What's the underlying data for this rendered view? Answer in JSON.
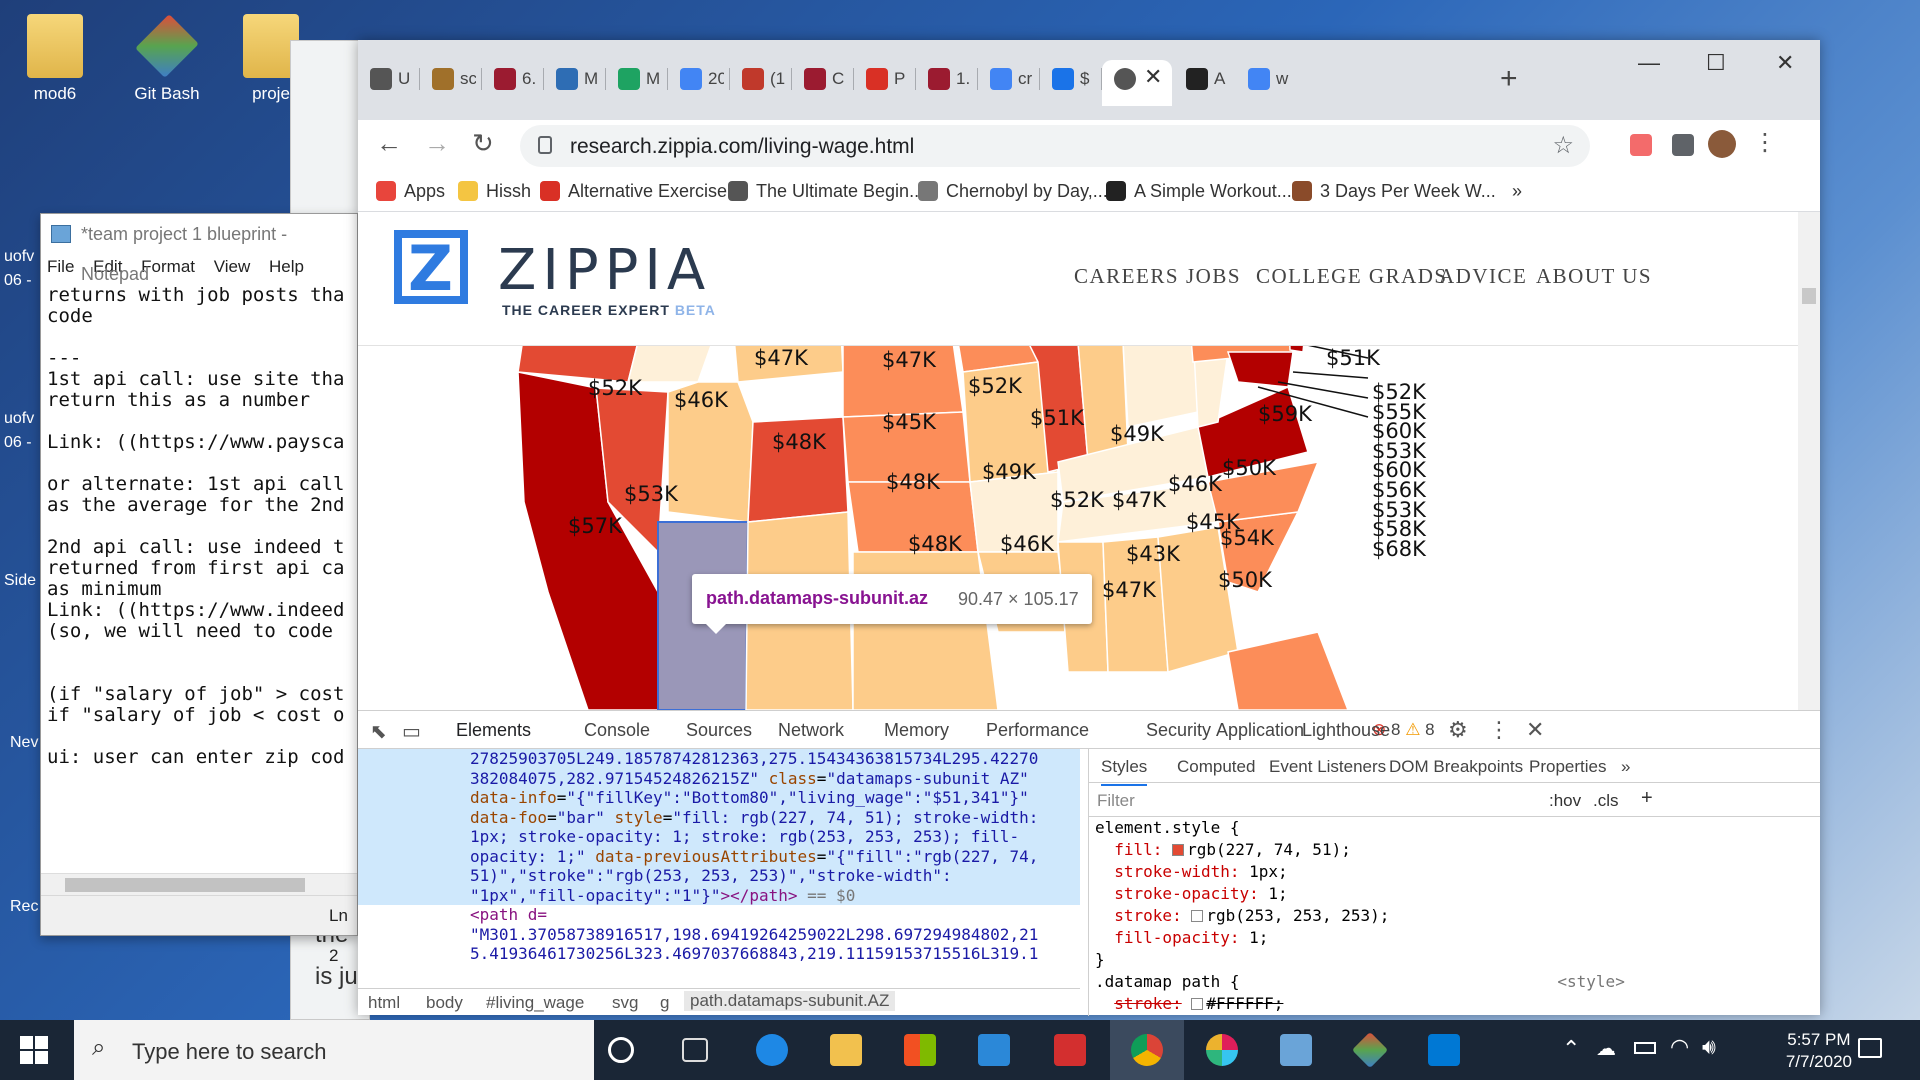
{
  "desktop": {
    "icons": [
      {
        "label": "mod6"
      },
      {
        "label": "Git Bash"
      },
      {
        "label": "proje"
      }
    ],
    "side_labels": [
      "uofv",
      "06 -",
      "uofv",
      "06 -",
      "Side",
      "Nev",
      "Rec"
    ]
  },
  "notepad": {
    "title": "*team project 1 blueprint - Notepad",
    "menu": [
      "File",
      "Edit",
      "Format",
      "View",
      "Help"
    ],
    "lines": [
      "returns with job posts tha",
      "code",
      "",
      "---",
      "1st api call: use site tha",
      "return this as a number",
      "",
      "Link: ((https://www.paysca",
      "",
      "or alternate: 1st api call",
      "as the average for the 2nd",
      "",
      "2nd api call: use indeed t",
      "returned from first api ca",
      "as minimum",
      "Link: ((https://www.indeed",
      "(so, we will need to code",
      "",
      "",
      "(if \"salary of job\" > cost",
      "if \"salary of job < cost o",
      "",
      "ui: user can enter zip cod"
    ],
    "status": "Ln 2"
  },
  "bg_window": {
    "fragments": [
      "the",
      "is ju"
    ]
  },
  "browser": {
    "tabs": [
      {
        "title": "U",
        "color": "#555"
      },
      {
        "title": "sc",
        "color": "#a0702a"
      },
      {
        "title": "6.",
        "color": "#9b1b30"
      },
      {
        "title": "M",
        "color": "#2e6db4"
      },
      {
        "title": "M",
        "color": "#1ea362"
      },
      {
        "title": "20",
        "color": "#4285f4"
      },
      {
        "title": "(1",
        "color": "#c0392b"
      },
      {
        "title": "C",
        "color": "#9b1b30"
      },
      {
        "title": "P",
        "color": "#d93025"
      },
      {
        "title": "1.",
        "color": "#9b1b30"
      },
      {
        "title": "cr",
        "color": "#4285f4"
      },
      {
        "title": "$",
        "color": "#1a73e8"
      }
    ],
    "active_tab_close": "✕",
    "trailing_tabs": [
      {
        "title": "A",
        "color": "#222"
      },
      {
        "title": "w",
        "color": "#4285f4"
      }
    ],
    "url": "research.zippia.com/living-wage.html",
    "bookmarks": [
      {
        "label": "Apps",
        "color": "#e8453c"
      },
      {
        "label": "Hissh",
        "color": "#f4c542"
      },
      {
        "label": "Alternative Exercise...",
        "color": "#d93025"
      },
      {
        "label": "The Ultimate Begin...",
        "color": "#555"
      },
      {
        "label": "Chernobyl by Day,...",
        "color": "#777"
      },
      {
        "label": "A Simple Workout...",
        "color": "#222"
      },
      {
        "label": "3 Days Per Week W...",
        "color": "#8a4b2a"
      }
    ],
    "bookmarks_more": "»"
  },
  "site": {
    "logo": "ZIPPIA",
    "tagline": "THE CAREER EXPERT",
    "beta": "BETA",
    "nav": [
      "CAREERS",
      "JOBS",
      "COLLEGE GRADS",
      "ADVICE",
      "ABOUT US"
    ],
    "map_labels": [
      "$52K",
      "$46K",
      "$47K",
      "$47K",
      "$52K",
      "$45K",
      "$48K",
      "$51K",
      "$49K",
      "$59K",
      "$48K",
      "$49K",
      "$53K",
      "$57K",
      "$52K",
      "$47K",
      "$46K",
      "$45K",
      "$50K",
      "$54K",
      "$48K",
      "$46K",
      "$43K",
      "$47K",
      "$50K",
      "$47K",
      "$51K"
    ],
    "map_right_labels": [
      "$52K",
      "$55K",
      "$60K",
      "$53K",
      "$60K",
      "$56K",
      "$53K",
      "$58K",
      "$68K"
    ],
    "tooltip_selector": "path.datamaps-subunit.az",
    "tooltip_dims": "90.47 × 105.17"
  },
  "devtools": {
    "tabs": [
      "Elements",
      "Console",
      "Sources",
      "Network",
      "Memory",
      "Performance",
      "Security",
      "Application",
      "Lighthouse"
    ],
    "errors": "8",
    "warnings": "8",
    "code": {
      "l1": "27825903705L249.18578742812363,275.15434363815734L295.42270",
      "l2": "382084075,282.97154524826215Z\"",
      "class_attr": "class",
      "class_val": "\"datamaps-subunit AZ\"",
      "info_attr": "data-info",
      "info_val": "\"{\"fillKey\":\"Bottom80\",\"living_wage\":\"$51,341\"}\"",
      "foo_attr": "data-foo",
      "foo_val": "\"bar\"",
      "style_attr": "style",
      "style_val1": "\"fill: rgb(227, 74, 51); stroke-width:",
      "style_val2": "1px; stroke-opacity: 1; stroke: rgb(253, 253, 253); fill-",
      "style_val3": "opacity: 1;\"",
      "prev_attr": "data-previousAttributes",
      "prev_val1": "\"{\"fill\":\"rgb(227, 74,",
      "prev_val2": "51)\",\"stroke\":\"rgb(253, 253, 253)\",\"stroke-width\":",
      "prev_val3": "\"1px\",\"fill-opacity\":\"1\"}\"",
      "close_tag": "></path>",
      "eq": "== $0",
      "next_tag": "<path d=",
      "next_l1": "\"M301.37058738916517,198.69419264259022L298.697294984802,21",
      "next_l2": "5.41936461730256L323.4697037668843,219.11159153715516L319.1"
    },
    "crumbs": [
      "html",
      "body",
      "#living_wage",
      "svg",
      "g",
      "path.datamaps-subunit.AZ"
    ],
    "style_tabs": [
      "Styles",
      "Computed",
      "Event Listeners",
      "DOM Breakpoints",
      "Properties",
      "»"
    ],
    "filter_placeholder": "Filter",
    "hov": ":hov",
    "cls": ".cls",
    "rules": {
      "selector1": "element.style {",
      "fill_prop": "fill:",
      "fill_val": "rgb(227, 74, 51);",
      "sw_prop": "stroke-width:",
      "sw_val": "1px;",
      "so_prop": "stroke-opacity:",
      "so_val": "1;",
      "stroke_prop": "stroke:",
      "stroke_val": "rgb(253, 253, 253);",
      "fo_prop": "fill-opacity:",
      "fo_val": "1;",
      "close": "}",
      "selector2": ".datamap path {",
      "source2": "<style>",
      "stroke2_prop": "stroke:",
      "stroke2_val": "#FFFFFF;"
    }
  },
  "taskbar": {
    "search_placeholder": "Type here to search",
    "time": "5:57 PM",
    "date": "7/7/2020"
  }
}
